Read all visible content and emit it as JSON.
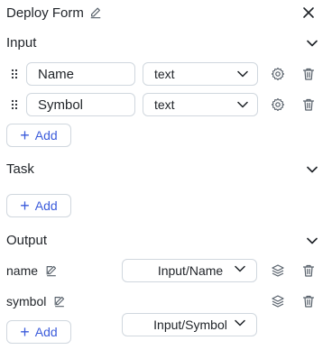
{
  "header": {
    "title": "Deploy Form"
  },
  "input": {
    "title": "Input",
    "rows": [
      {
        "name": "Name",
        "type": "text"
      },
      {
        "name": "Symbol",
        "type": "text"
      }
    ],
    "add_label": "Add"
  },
  "task": {
    "title": "Task",
    "add_label": "Add"
  },
  "output": {
    "title": "Output",
    "rows": [
      {
        "label": "name",
        "source": "Input/Name"
      },
      {
        "label": "symbol",
        "source": "Input/Symbol"
      }
    ],
    "add_label": "Add"
  },
  "colors": {
    "accent": "#3b5bdb",
    "border": "#d0d7de",
    "text": "#1f2328",
    "icon": "#57606a"
  }
}
